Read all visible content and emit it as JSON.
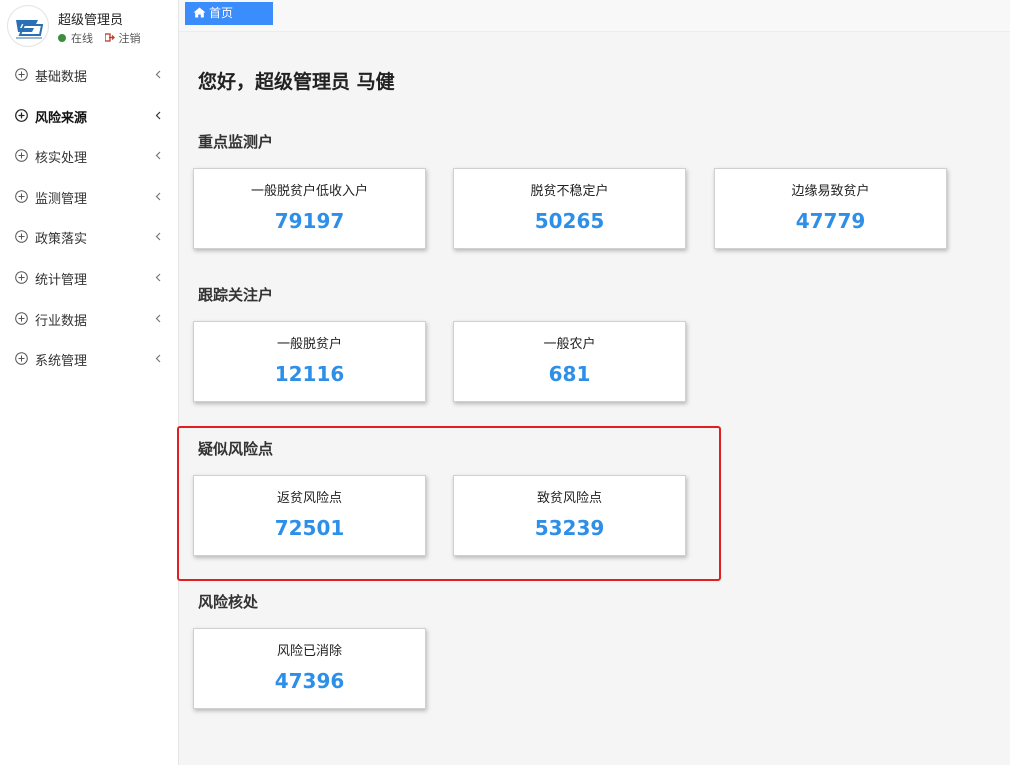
{
  "user": {
    "name": "超级管理员",
    "status": "在线",
    "logout": "注销"
  },
  "menu": [
    {
      "label": "基础数据",
      "active": false
    },
    {
      "label": "风险来源",
      "active": true
    },
    {
      "label": "核实处理",
      "active": false
    },
    {
      "label": "监测管理",
      "active": false
    },
    {
      "label": "政策落实",
      "active": false
    },
    {
      "label": "统计管理",
      "active": false
    },
    {
      "label": "行业数据",
      "active": false
    },
    {
      "label": "系统管理",
      "active": false
    }
  ],
  "tabs": {
    "home": "首页"
  },
  "greeting": "您好，超级管理员 马健",
  "sections": [
    {
      "title": "重点监测户",
      "cards": [
        {
          "label": "一般脱贫户低收入户",
          "value": "79197"
        },
        {
          "label": "脱贫不稳定户",
          "value": "50265"
        },
        {
          "label": "边缘易致贫户",
          "value": "47779"
        }
      ]
    },
    {
      "title": "跟踪关注户",
      "cards": [
        {
          "label": "一般脱贫户",
          "value": "12116"
        },
        {
          "label": "一般农户",
          "value": "681"
        }
      ]
    },
    {
      "title": "疑似风险点",
      "cards": [
        {
          "label": "返贫风险点",
          "value": "72501"
        },
        {
          "label": "致贫风险点",
          "value": "53239"
        }
      ]
    },
    {
      "title": "风险核处",
      "cards": [
        {
          "label": "风险已消除",
          "value": "47396"
        }
      ]
    }
  ],
  "colors": {
    "accent": "#3c8dfc",
    "value": "#2e8fe9",
    "highlight": "#e02020",
    "online": "#3c8d3c"
  }
}
